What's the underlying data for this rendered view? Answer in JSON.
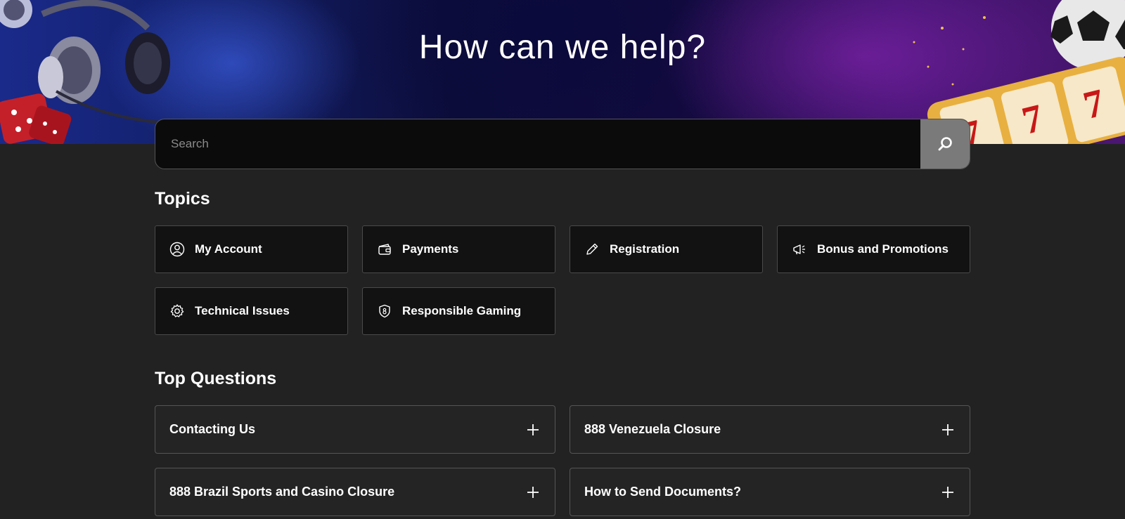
{
  "hero": {
    "title": "How can we help?"
  },
  "search": {
    "placeholder": "Search",
    "button_icon": "search-icon"
  },
  "topics": {
    "heading": "Topics",
    "items": [
      {
        "label": "My Account",
        "icon": "user-circle-icon"
      },
      {
        "label": "Payments",
        "icon": "wallet-icon"
      },
      {
        "label": "Registration",
        "icon": "pencil-icon"
      },
      {
        "label": "Bonus and Promotions",
        "icon": "megaphone-icon"
      },
      {
        "label": "Technical Issues",
        "icon": "gear-icon"
      },
      {
        "label": "Responsible Gaming",
        "icon": "shield-icon"
      }
    ]
  },
  "top_questions": {
    "heading": "Top Questions",
    "items": [
      {
        "label": "Contacting Us",
        "icon": "plus-icon"
      },
      {
        "label": "888 Venezuela Closure",
        "icon": "plus-icon"
      },
      {
        "label": "888 Brazil Sports and Casino Closure",
        "icon": "plus-icon"
      },
      {
        "label": "How to Send Documents?",
        "icon": "plus-icon"
      }
    ]
  },
  "colors": {
    "page_background": "#222222",
    "card_background": "#121212",
    "search_button": "#7a7a7a",
    "text": "#ffffff"
  }
}
